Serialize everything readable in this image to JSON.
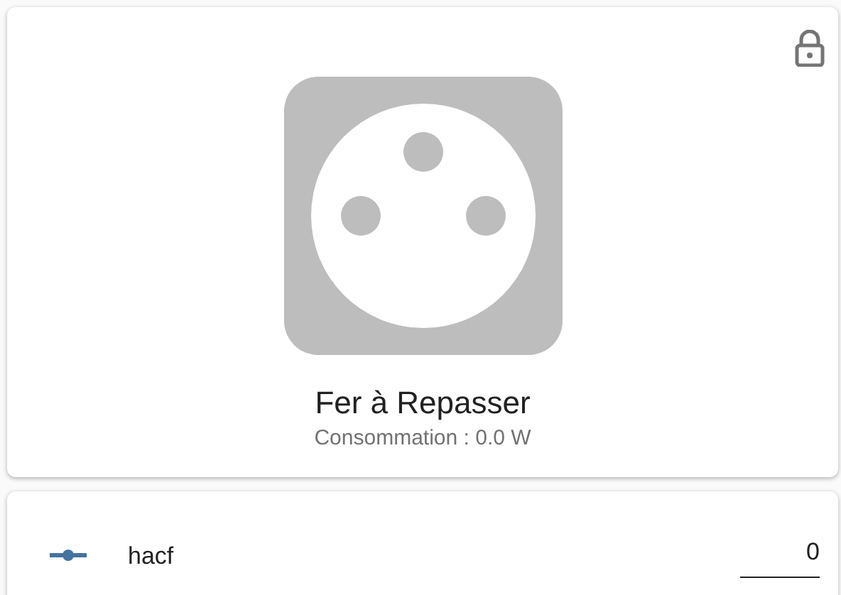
{
  "device": {
    "name": "Fer à Repasser",
    "state": "Consommation : 0.0 W",
    "on": false,
    "locked": true
  },
  "entities": [
    {
      "kind": "input_number",
      "name": "hacf",
      "value": "0"
    }
  ]
}
